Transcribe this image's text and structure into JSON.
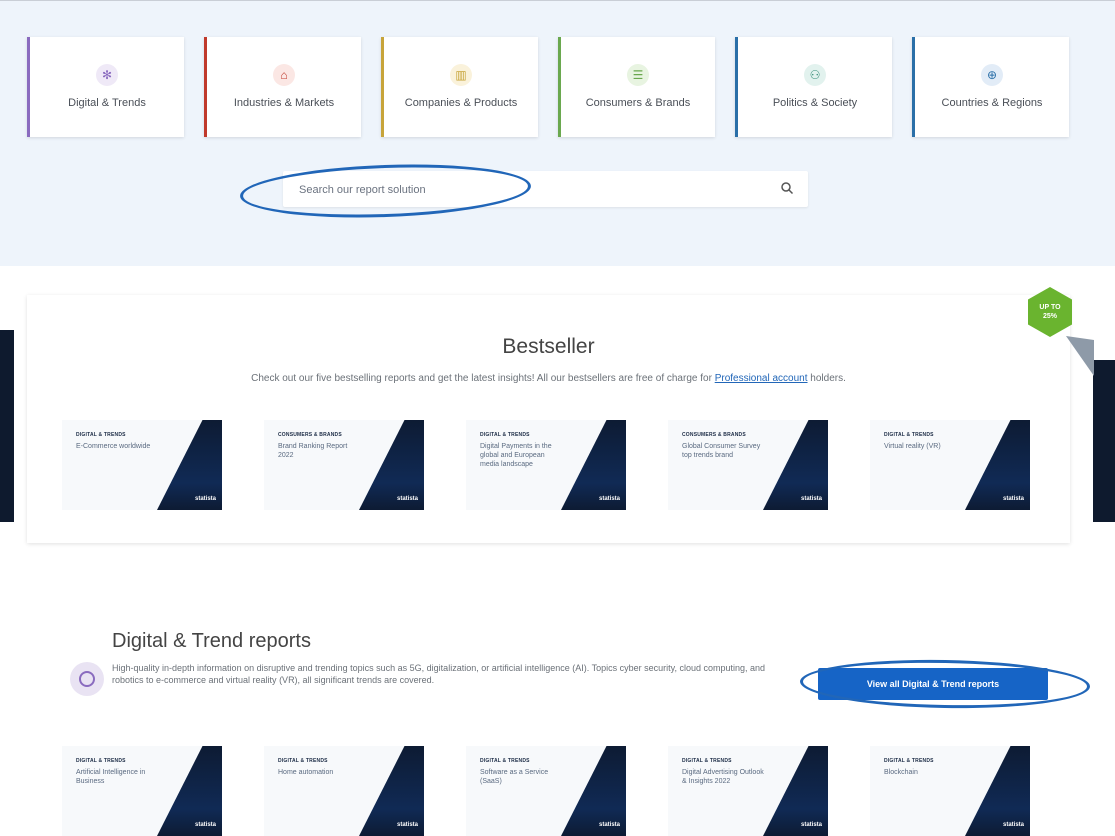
{
  "categories": [
    {
      "label": "Digital & Trends",
      "icon": "digital-icon",
      "color": "#8a6bbf",
      "glyph": "✻"
    },
    {
      "label": "Industries & Markets",
      "icon": "factory-icon",
      "color": "#c0392b",
      "glyph": "⌂"
    },
    {
      "label": "Companies & Products",
      "icon": "building-icon",
      "color": "#c7a43a",
      "glyph": "▥"
    },
    {
      "label": "Consumers & Brands",
      "icon": "shopping-icon",
      "color": "#6aa84f",
      "glyph": "☰"
    },
    {
      "label": "Politics & Society",
      "icon": "people-icon",
      "color": "#2a6fa8",
      "glyph": "⚇"
    },
    {
      "label": "Countries & Regions",
      "icon": "globe-icon",
      "color": "#2a6fa8",
      "glyph": "⊕"
    }
  ],
  "search": {
    "placeholder": "Search our report solution"
  },
  "badge": {
    "line1": "UP TO",
    "line2": "25%"
  },
  "bestseller": {
    "title": "Bestseller",
    "desc_before": "Check out our five bestselling reports and get the latest insights! All our bestsellers are free of charge for ",
    "link": "Professional account",
    "desc_after": " holders.",
    "reports": [
      {
        "tag": "DIGITAL & TRENDS",
        "title": "E-Commerce worldwide",
        "logo": "statista"
      },
      {
        "tag": "CONSUMERS & BRANDS",
        "title": "Brand Ranking Report 2022",
        "logo": "statista"
      },
      {
        "tag": "DIGITAL & TRENDS",
        "title": "Digital Payments in the global and European media landscape",
        "logo": "statista"
      },
      {
        "tag": "CONSUMERS & BRANDS",
        "title": "Global Consumer Survey top trends brand",
        "logo": "statista"
      },
      {
        "tag": "DIGITAL & TRENDS",
        "title": "Virtual reality (VR)",
        "logo": "statista"
      }
    ]
  },
  "digital_section": {
    "title": "Digital & Trend reports",
    "desc": "High-quality in-depth information on disruptive and trending topics such as 5G, digitalization, or artificial intelligence (AI). Topics cyber security, cloud computing, and robotics to e-commerce and virtual reality (VR), all significant trends are covered.",
    "button": "View all Digital & Trend reports",
    "reports": [
      {
        "tag": "DIGITAL & TRENDS",
        "title": "Artificial Intelligence in Business",
        "logo": "statista"
      },
      {
        "tag": "DIGITAL & TRENDS",
        "title": "Home automation",
        "logo": "statista"
      },
      {
        "tag": "DIGITAL & TRENDS",
        "title": "Software as a Service (SaaS)",
        "logo": "statista"
      },
      {
        "tag": "DIGITAL & TRENDS",
        "title": "Digital Advertising Outlook & Insights 2022",
        "logo": "statista"
      },
      {
        "tag": "DIGITAL & TRENDS",
        "title": "Blockchain",
        "logo": "statista"
      }
    ]
  }
}
